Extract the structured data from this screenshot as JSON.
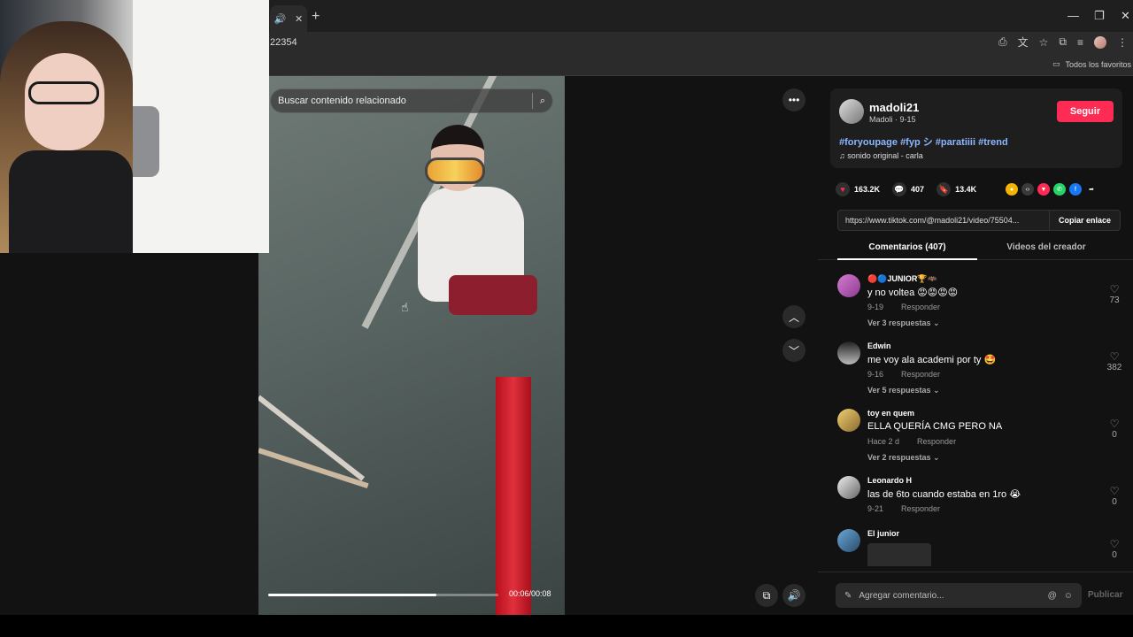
{
  "browser": {
    "tab_icons": [
      "🔊",
      "✕"
    ],
    "new_tab": "+",
    "window_controls": [
      "—",
      "❐",
      "✕"
    ],
    "url": "22354",
    "bookmark_folder": "Todos los favoritos"
  },
  "video": {
    "search_placeholder": "Buscar contenido relacionado",
    "time": "00:06/00:08",
    "progress": 0.73,
    "more_icon": "•••",
    "up_icon": "︿",
    "down_icon": "﹀"
  },
  "creator": {
    "username": "madoli21",
    "subtitle": "Madoli · 9-15",
    "follow_label": "Seguir",
    "hashtags": "#foryoupage #fyp シ #paratiiii #trend",
    "sound": "♫  sonido original - carla"
  },
  "stats": {
    "likes": "163.2K",
    "comments": "407",
    "saves": "13.4K"
  },
  "link": {
    "url": "https://www.tiktok.com/@madoli21/video/75504...",
    "copy_label": "Copiar enlace"
  },
  "tabs": {
    "comments": "Comentarios (407)",
    "creator_videos": "Videos del creador"
  },
  "comments": [
    {
      "user": "🔴🔵JUNIOR🏆🦇",
      "text": "y no voltea 😡😡😡😡",
      "date": "9-19",
      "reply": "Responder",
      "replies": "Ver 3 respuestas ⌄",
      "likes": "73"
    },
    {
      "user": "Edwin",
      "text": "me voy ala academi por ty 🤩",
      "date": "9-16",
      "reply": "Responder",
      "replies": "Ver 5 respuestas ⌄",
      "likes": "382"
    },
    {
      "user": "toy en quem",
      "text": "ELLA QUERÍA CMG PERO NA",
      "date": "Hace 2 d",
      "reply": "Responder",
      "replies": "Ver 2 respuestas ⌄",
      "likes": "0"
    },
    {
      "user": "Leonardo H",
      "text": "las de 6to cuando estaba en 1ro 😭",
      "date": "9-21",
      "reply": "Responder",
      "replies": "",
      "likes": "0"
    },
    {
      "user": "El junior",
      "text": "",
      "date": "",
      "reply": "",
      "replies": "",
      "likes": "0"
    }
  ],
  "add_comment": {
    "placeholder": "Agregar comentario...",
    "publish": "Publicar"
  }
}
